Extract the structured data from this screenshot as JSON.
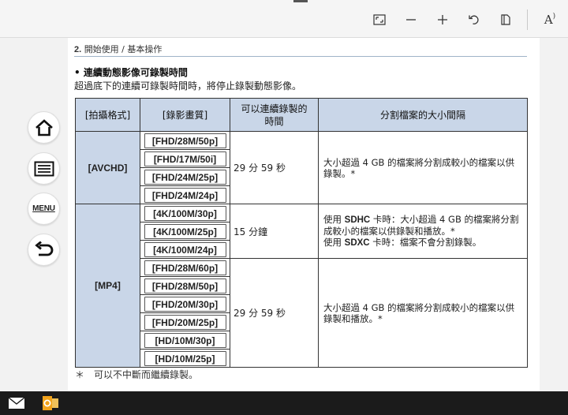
{
  "toolbar": {
    "icons": [
      "fit-page-icon",
      "zoom-out-icon",
      "zoom-in-icon",
      "rotate-icon",
      "page-view-icon",
      "read-aloud-icon"
    ],
    "read_aloud_label": "A"
  },
  "nav": {
    "menu_label": "MENU"
  },
  "page": {
    "chapter_num": "2.",
    "chapter_title": "開始使用 / 基本操作",
    "section_title": "• 連續動態影像可錄製時間",
    "section_desc": "超過底下的連續可錄製時間時，將停止錄製動態影像。",
    "table": {
      "headers": [
        "[拍攝格式]",
        "[錄影畫質]",
        "可以連續錄製的",
        "時間",
        "分割檔案的大小間隔"
      ],
      "groups": [
        {
          "format": "[AVCHD]",
          "qualities": [
            "[FHD/28M/50p]",
            "[FHD/17M/50i]",
            "[FHD/24M/25p]",
            "[FHD/24M/24p]"
          ],
          "time": "29 分 59 秒",
          "split": "大小超過 4 GB 的檔案將分割成較小的檔案以供錄製。*"
        },
        {
          "format": "[MP4]",
          "qualities": [
            "[4K/100M/30p]",
            "[4K/100M/25p]",
            "[4K/100M/24p]"
          ],
          "time": "15 分鐘",
          "split_sdhc_prefix": "使用 ",
          "split_sdhc_brand": "SDHC",
          "split_sdhc_text": " 卡時：大小超過 4 GB 的檔案將分割成較小的檔案以供錄製和播放。*",
          "split_sdxc_prefix": "使用 ",
          "split_sdxc_brand": "SDXC",
          "split_sdxc_text": " 卡時：檔案不會分割錄製。"
        },
        {
          "qualities": [
            "[FHD/28M/60p]",
            "[FHD/28M/50p]",
            "[FHD/20M/30p]",
            "[FHD/20M/25p]",
            "[HD/10M/30p]",
            "[HD/10M/25p]"
          ],
          "time": "29 分 59 秒",
          "split": "大小超過 4 GB 的檔案將分割成較小的檔案以供錄製和播放。*"
        }
      ]
    },
    "footnote": "＊　可以不中斷而繼續錄製。"
  },
  "taskbar": {
    "icons": [
      "mail-icon",
      "outlook-icon"
    ]
  }
}
